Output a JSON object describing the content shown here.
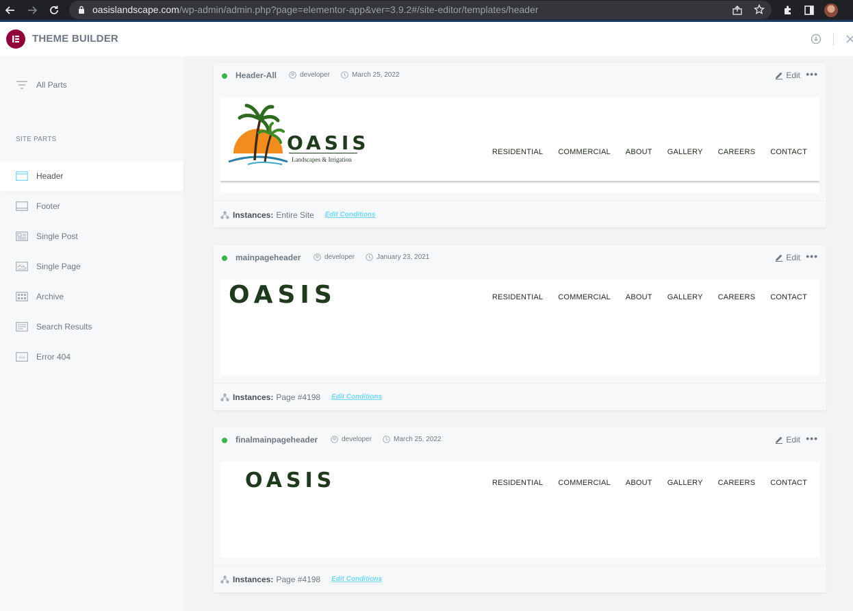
{
  "browser": {
    "url_host": "oasislandscape.com",
    "url_path": "/wp-admin/admin.php?page=elementor-app&ver=3.9.2#/site-editor/templates/header"
  },
  "app": {
    "title": "THEME BUILDER",
    "accent": "#92003b"
  },
  "sidebar": {
    "all_parts": "All Parts",
    "section_label": "SITE PARTS",
    "items": [
      {
        "label": "Header",
        "icon": "header-layout-icon"
      },
      {
        "label": "Footer",
        "icon": "footer-layout-icon"
      },
      {
        "label": "Single Post",
        "icon": "single-post-icon"
      },
      {
        "label": "Single Page",
        "icon": "single-page-icon"
      },
      {
        "label": "Archive",
        "icon": "archive-icon"
      },
      {
        "label": "Search Results",
        "icon": "search-results-icon"
      },
      {
        "label": "Error 404",
        "icon": "error-404-icon"
      }
    ]
  },
  "templates": [
    {
      "title": "Header-All",
      "author": "developer",
      "date": "March 25, 2022",
      "edit_label": "Edit",
      "instances_label": "Instances:",
      "instances_value": "Entire Site",
      "edit_conditions": "Edit Conditions",
      "logo_text": "OASIS",
      "logo_tagline": "Landscapes & Irrigation",
      "nav": [
        "RESIDENTIAL",
        "COMMERCIAL",
        "ABOUT",
        "GALLERY",
        "CAREERS",
        "CONTACT"
      ]
    },
    {
      "title": "mainpageheader",
      "author": "developer",
      "date": "January 23, 2021",
      "edit_label": "Edit",
      "instances_label": "Instances:",
      "instances_value": "Page #4198",
      "edit_conditions": "Edit Conditions",
      "logo_text": "OASIS",
      "nav": [
        "RESIDENTIAL",
        "COMMERCIAL",
        "ABOUT",
        "GALLERY",
        "CAREERS",
        "CONTACT"
      ]
    },
    {
      "title": "finalmainpageheader",
      "author": "developer",
      "date": "March 25, 2022",
      "edit_label": "Edit",
      "instances_label": "Instances:",
      "instances_value": "Page #4198",
      "edit_conditions": "Edit Conditions",
      "logo_text": "OASIS",
      "nav": [
        "RESIDENTIAL",
        "COMMERCIAL",
        "ABOUT",
        "GALLERY",
        "CAREERS",
        "CONTACT"
      ]
    }
  ],
  "colors": {
    "status_active": "#39b54a",
    "edit_conditions_link": "#71d7f7",
    "logo_green": "#1f3a1c"
  }
}
